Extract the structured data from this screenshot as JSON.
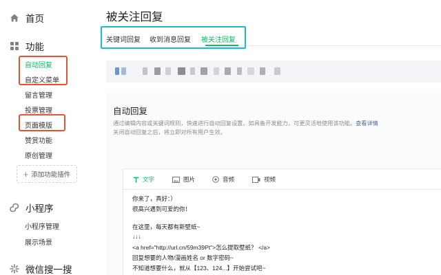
{
  "sidebar": {
    "home_label": "首页",
    "features_label": "功能",
    "items": [
      {
        "label": "自动回复",
        "active": true
      },
      {
        "label": "自定义菜单",
        "active": false
      },
      {
        "label": "留言管理",
        "active": false
      },
      {
        "label": "投票管理",
        "active": false
      },
      {
        "label": "页面模版",
        "active": false
      },
      {
        "label": "赞赏功能",
        "active": false
      },
      {
        "label": "原创管理",
        "active": false
      }
    ],
    "add_plugin_label": "添加功能插件",
    "miniprogram_label": "小程序",
    "miniprogram_items": [
      {
        "label": "小程序管理"
      },
      {
        "label": "展示场景"
      }
    ],
    "search_label": "微信搜一搜"
  },
  "page": {
    "title": "被关注回复",
    "tabs": [
      {
        "label": "关键词回复",
        "active": false
      },
      {
        "label": "收到消息回复",
        "active": false
      },
      {
        "label": "被关注回复",
        "active": true
      }
    ]
  },
  "auto_reply": {
    "title": "自动回复",
    "desc_line1": "通过编辑内容或关键词规则，快速进行自动回复设置。如具备开发能力，可更灵活地使用该功能。",
    "desc_link": "查看详情",
    "desc_line2": "关闭自动回复之后，将立即对所有用户生效。"
  },
  "editor": {
    "tools": [
      {
        "label": "文字",
        "icon": "text-icon",
        "active": true
      },
      {
        "label": "图片",
        "icon": "image-icon",
        "active": false
      },
      {
        "label": "音频",
        "icon": "audio-icon",
        "active": false
      },
      {
        "label": "视频",
        "icon": "video-icon",
        "active": false
      }
    ],
    "lines": [
      "你来了，真好：）",
      "很高兴遇到可爱的你！",
      "",
      "在这里，每天都有新壁纸~",
      "↓↓↓",
      "<a href=\"http://url.cn/59m39Pt\">怎么提取壁纸？ </a>",
      "回复想要的人物/漫画姓名 or 数字密码~",
      "不知道想要什么，就从【123、124...】开始尝试吧~"
    ]
  },
  "colors": {
    "accent_green": "#07c160",
    "highlight_red": "#e2532f",
    "highlight_cyan": "#1fb8cf",
    "link_blue": "#576b95"
  }
}
